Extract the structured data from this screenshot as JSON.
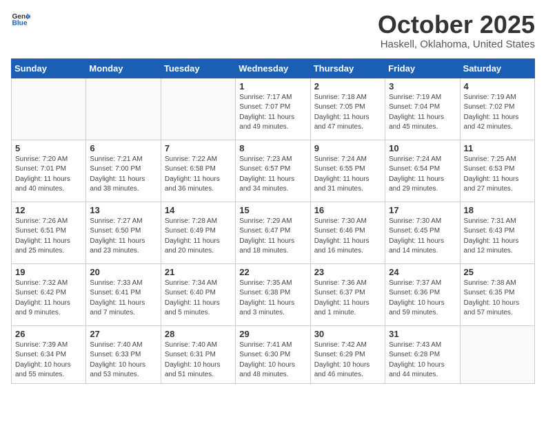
{
  "logo": {
    "general": "General",
    "blue": "Blue"
  },
  "header": {
    "month": "October 2025",
    "location": "Haskell, Oklahoma, United States"
  },
  "days_of_week": [
    "Sunday",
    "Monday",
    "Tuesday",
    "Wednesday",
    "Thursday",
    "Friday",
    "Saturday"
  ],
  "weeks": [
    [
      {
        "day": "",
        "info": ""
      },
      {
        "day": "",
        "info": ""
      },
      {
        "day": "",
        "info": ""
      },
      {
        "day": "1",
        "info": "Sunrise: 7:17 AM\nSunset: 7:07 PM\nDaylight: 11 hours\nand 49 minutes."
      },
      {
        "day": "2",
        "info": "Sunrise: 7:18 AM\nSunset: 7:05 PM\nDaylight: 11 hours\nand 47 minutes."
      },
      {
        "day": "3",
        "info": "Sunrise: 7:19 AM\nSunset: 7:04 PM\nDaylight: 11 hours\nand 45 minutes."
      },
      {
        "day": "4",
        "info": "Sunrise: 7:19 AM\nSunset: 7:02 PM\nDaylight: 11 hours\nand 42 minutes."
      }
    ],
    [
      {
        "day": "5",
        "info": "Sunrise: 7:20 AM\nSunset: 7:01 PM\nDaylight: 11 hours\nand 40 minutes."
      },
      {
        "day": "6",
        "info": "Sunrise: 7:21 AM\nSunset: 7:00 PM\nDaylight: 11 hours\nand 38 minutes."
      },
      {
        "day": "7",
        "info": "Sunrise: 7:22 AM\nSunset: 6:58 PM\nDaylight: 11 hours\nand 36 minutes."
      },
      {
        "day": "8",
        "info": "Sunrise: 7:23 AM\nSunset: 6:57 PM\nDaylight: 11 hours\nand 34 minutes."
      },
      {
        "day": "9",
        "info": "Sunrise: 7:24 AM\nSunset: 6:55 PM\nDaylight: 11 hours\nand 31 minutes."
      },
      {
        "day": "10",
        "info": "Sunrise: 7:24 AM\nSunset: 6:54 PM\nDaylight: 11 hours\nand 29 minutes."
      },
      {
        "day": "11",
        "info": "Sunrise: 7:25 AM\nSunset: 6:53 PM\nDaylight: 11 hours\nand 27 minutes."
      }
    ],
    [
      {
        "day": "12",
        "info": "Sunrise: 7:26 AM\nSunset: 6:51 PM\nDaylight: 11 hours\nand 25 minutes."
      },
      {
        "day": "13",
        "info": "Sunrise: 7:27 AM\nSunset: 6:50 PM\nDaylight: 11 hours\nand 23 minutes."
      },
      {
        "day": "14",
        "info": "Sunrise: 7:28 AM\nSunset: 6:49 PM\nDaylight: 11 hours\nand 20 minutes."
      },
      {
        "day": "15",
        "info": "Sunrise: 7:29 AM\nSunset: 6:47 PM\nDaylight: 11 hours\nand 18 minutes."
      },
      {
        "day": "16",
        "info": "Sunrise: 7:30 AM\nSunset: 6:46 PM\nDaylight: 11 hours\nand 16 minutes."
      },
      {
        "day": "17",
        "info": "Sunrise: 7:30 AM\nSunset: 6:45 PM\nDaylight: 11 hours\nand 14 minutes."
      },
      {
        "day": "18",
        "info": "Sunrise: 7:31 AM\nSunset: 6:43 PM\nDaylight: 11 hours\nand 12 minutes."
      }
    ],
    [
      {
        "day": "19",
        "info": "Sunrise: 7:32 AM\nSunset: 6:42 PM\nDaylight: 11 hours\nand 9 minutes."
      },
      {
        "day": "20",
        "info": "Sunrise: 7:33 AM\nSunset: 6:41 PM\nDaylight: 11 hours\nand 7 minutes."
      },
      {
        "day": "21",
        "info": "Sunrise: 7:34 AM\nSunset: 6:40 PM\nDaylight: 11 hours\nand 5 minutes."
      },
      {
        "day": "22",
        "info": "Sunrise: 7:35 AM\nSunset: 6:38 PM\nDaylight: 11 hours\nand 3 minutes."
      },
      {
        "day": "23",
        "info": "Sunrise: 7:36 AM\nSunset: 6:37 PM\nDaylight: 11 hours\nand 1 minute."
      },
      {
        "day": "24",
        "info": "Sunrise: 7:37 AM\nSunset: 6:36 PM\nDaylight: 10 hours\nand 59 minutes."
      },
      {
        "day": "25",
        "info": "Sunrise: 7:38 AM\nSunset: 6:35 PM\nDaylight: 10 hours\nand 57 minutes."
      }
    ],
    [
      {
        "day": "26",
        "info": "Sunrise: 7:39 AM\nSunset: 6:34 PM\nDaylight: 10 hours\nand 55 minutes."
      },
      {
        "day": "27",
        "info": "Sunrise: 7:40 AM\nSunset: 6:33 PM\nDaylight: 10 hours\nand 53 minutes."
      },
      {
        "day": "28",
        "info": "Sunrise: 7:40 AM\nSunset: 6:31 PM\nDaylight: 10 hours\nand 51 minutes."
      },
      {
        "day": "29",
        "info": "Sunrise: 7:41 AM\nSunset: 6:30 PM\nDaylight: 10 hours\nand 48 minutes."
      },
      {
        "day": "30",
        "info": "Sunrise: 7:42 AM\nSunset: 6:29 PM\nDaylight: 10 hours\nand 46 minutes."
      },
      {
        "day": "31",
        "info": "Sunrise: 7:43 AM\nSunset: 6:28 PM\nDaylight: 10 hours\nand 44 minutes."
      },
      {
        "day": "",
        "info": ""
      }
    ]
  ]
}
